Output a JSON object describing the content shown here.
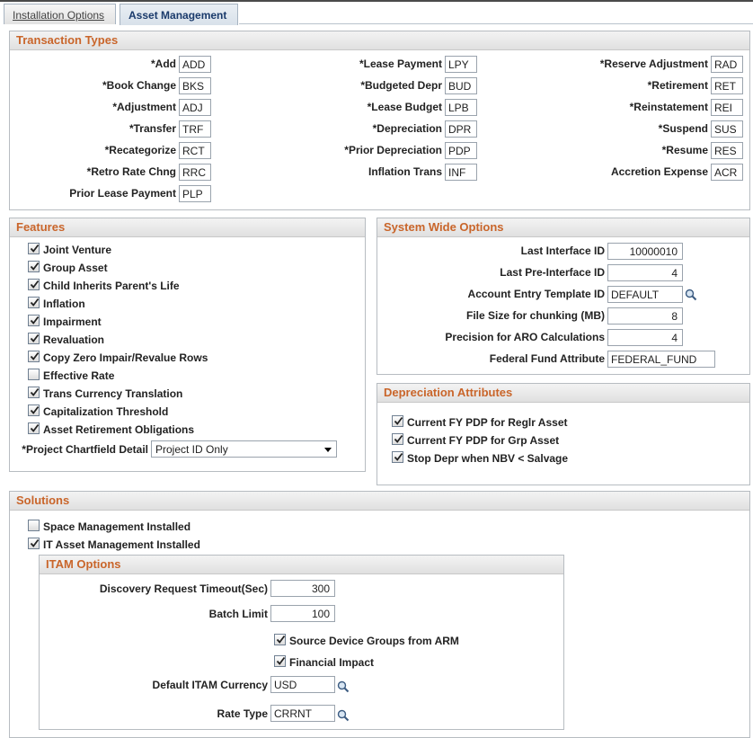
{
  "tabs": [
    {
      "label": "Installation Options"
    },
    {
      "label": "Asset Management"
    }
  ],
  "transaction_types": {
    "title": "Transaction Types",
    "col1": [
      {
        "label": "*Add",
        "value": "ADD"
      },
      {
        "label": "*Book Change",
        "value": "BKS"
      },
      {
        "label": "*Adjustment",
        "value": "ADJ"
      },
      {
        "label": "*Transfer",
        "value": "TRF"
      },
      {
        "label": "*Recategorize",
        "value": "RCT"
      },
      {
        "label": "*Retro Rate Chng",
        "value": "RRC"
      },
      {
        "label": "Prior Lease Payment",
        "value": "PLP"
      }
    ],
    "col2": [
      {
        "label": "*Lease Payment",
        "value": "LPY"
      },
      {
        "label": "*Budgeted Depr",
        "value": "BUD"
      },
      {
        "label": "*Lease Budget",
        "value": "LPB"
      },
      {
        "label": "*Depreciation",
        "value": "DPR"
      },
      {
        "label": "*Prior Depreciation",
        "value": "PDP"
      },
      {
        "label": "Inflation Trans",
        "value": "INF"
      }
    ],
    "col3": [
      {
        "label": "*Reserve Adjustment",
        "value": "RAD"
      },
      {
        "label": "*Retirement",
        "value": "RET"
      },
      {
        "label": "*Reinstatement",
        "value": "REI"
      },
      {
        "label": "*Suspend",
        "value": "SUS"
      },
      {
        "label": "*Resume",
        "value": "RES"
      },
      {
        "label": "Accretion Expense",
        "value": "ACR"
      }
    ]
  },
  "features": {
    "title": "Features",
    "items": [
      {
        "label": "Joint Venture",
        "checked": true
      },
      {
        "label": "Group Asset",
        "checked": true
      },
      {
        "label": "Child Inherits Parent's Life",
        "checked": true
      },
      {
        "label": "Inflation",
        "checked": true
      },
      {
        "label": "Impairment",
        "checked": true
      },
      {
        "label": "Revaluation",
        "checked": true
      },
      {
        "label": "Copy Zero Impair/Revalue Rows",
        "checked": true
      },
      {
        "label": "Effective Rate",
        "checked": false
      },
      {
        "label": "Trans Currency Translation",
        "checked": true
      },
      {
        "label": "Capitalization Threshold",
        "checked": true
      },
      {
        "label": "Asset Retirement Obligations",
        "checked": true
      }
    ],
    "project_label": "*Project Chartfield Detail",
    "project_value": "Project ID Only"
  },
  "system_wide": {
    "title": "System Wide Options",
    "last_interface_label": "Last Interface ID",
    "last_interface_value": "10000010",
    "last_pre_interface_label": "Last Pre-Interface ID",
    "last_pre_interface_value": "4",
    "account_template_label": "Account Entry Template ID",
    "account_template_value": "DEFAULT",
    "file_size_label": "File Size for chunking (MB)",
    "file_size_value": "8",
    "precision_label": "Precision for ARO Calculations",
    "precision_value": "4",
    "federal_fund_label": "Federal Fund Attribute",
    "federal_fund_value": "FEDERAL_FUND"
  },
  "depreciation": {
    "title": "Depreciation Attributes",
    "items": [
      {
        "label": "Current FY PDP for Reglr Asset",
        "checked": true
      },
      {
        "label": "Current FY PDP for Grp Asset",
        "checked": true
      },
      {
        "label": "Stop Depr when NBV < Salvage",
        "checked": true
      }
    ]
  },
  "solutions": {
    "title": "Solutions",
    "space_mgmt_label": "Space Management Installed",
    "space_mgmt_checked": false,
    "itam_installed_label": "IT Asset Management Installed",
    "itam_installed_checked": true
  },
  "itam": {
    "title": "ITAM Options",
    "timeout_label": "Discovery Request Timeout(Sec)",
    "timeout_value": "300",
    "batch_label": "Batch Limit",
    "batch_value": "100",
    "source_groups_label": "Source Device Groups from ARM",
    "source_groups_checked": true,
    "financial_label": "Financial Impact",
    "financial_checked": true,
    "currency_label": "Default ITAM Currency",
    "currency_value": "USD",
    "rate_label": "Rate Type",
    "rate_value": "CRRNT"
  },
  "icons": {
    "lookup": "magnifier-icon",
    "check": "checkmark-icon"
  }
}
